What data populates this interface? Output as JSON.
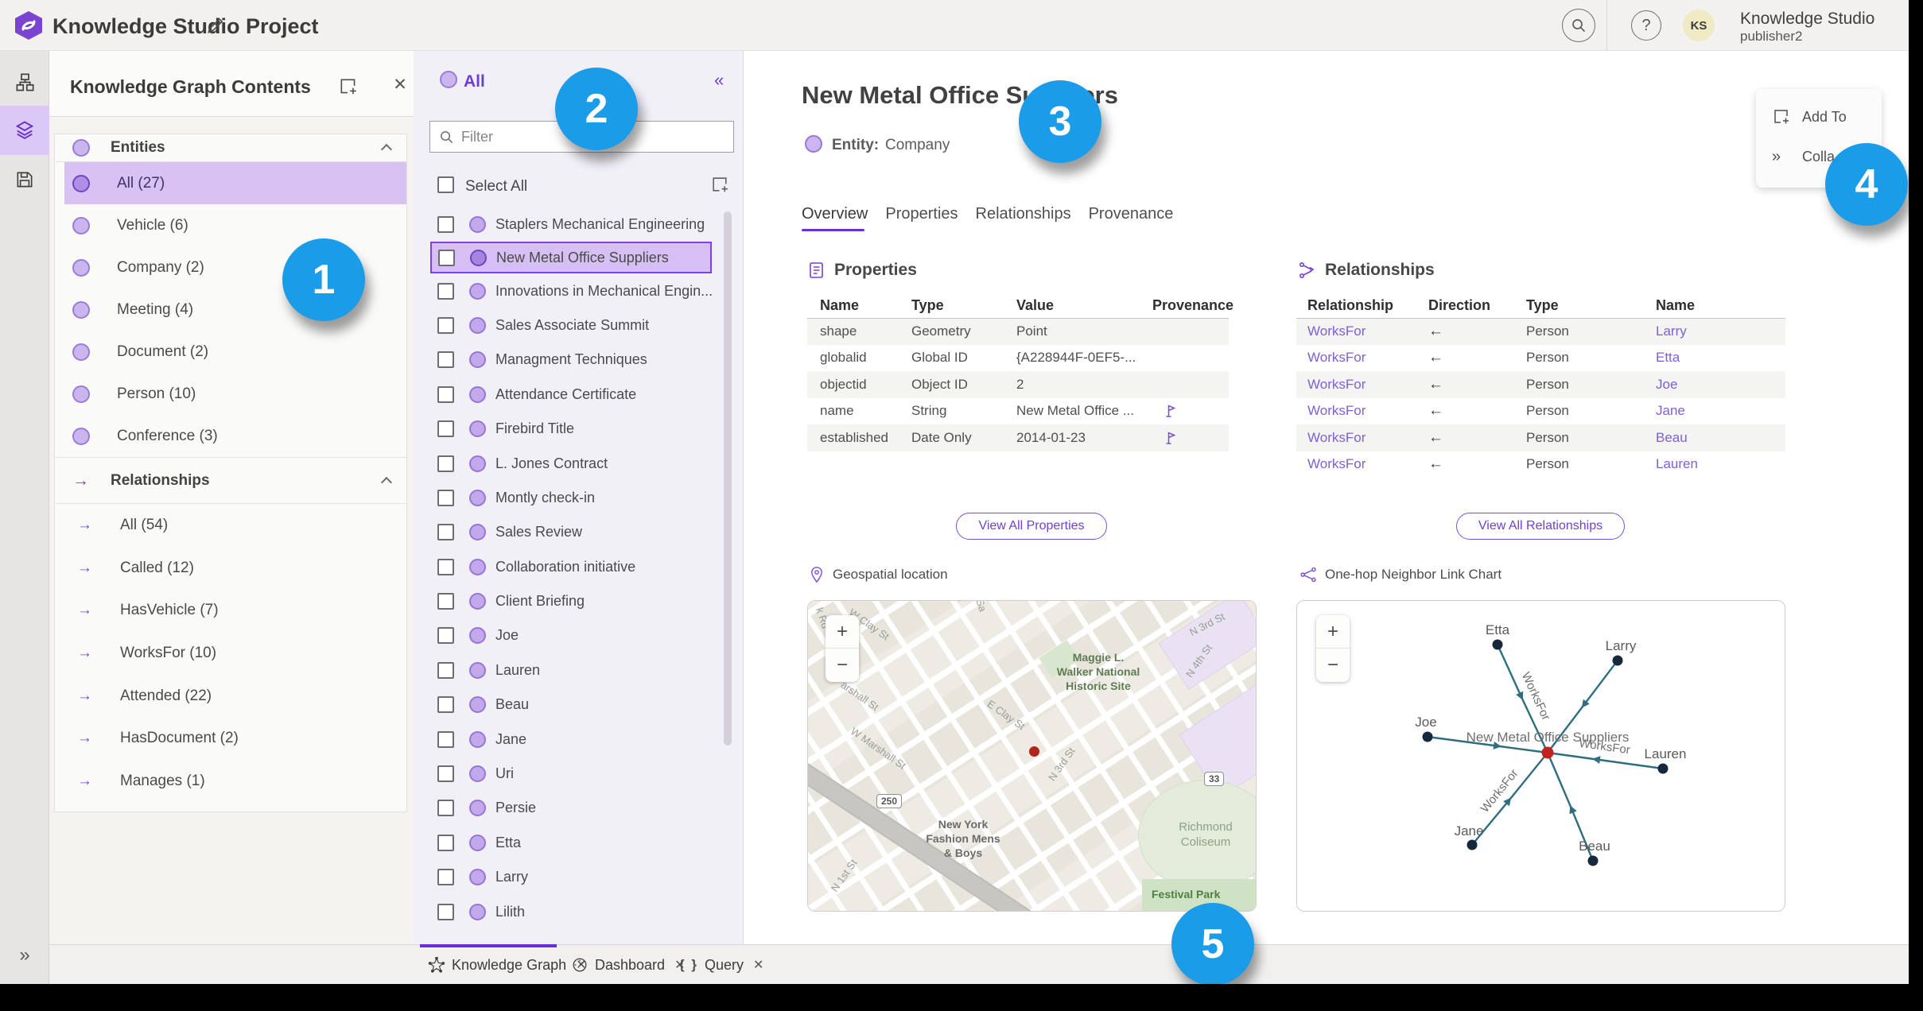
{
  "topbar": {
    "title": "Knowledge Studio Project",
    "help_glyph": "?",
    "avatar_initials": "KS",
    "account_name": "Knowledge Studio",
    "account_user": "publisher2"
  },
  "kg_panel": {
    "title": "Knowledge Graph Contents",
    "entities": {
      "label": "Entities",
      "items": [
        {
          "label": "All (27)",
          "selected": true
        },
        {
          "label": "Vehicle (6)"
        },
        {
          "label": "Company (2)"
        },
        {
          "label": "Meeting (4)"
        },
        {
          "label": "Document (2)"
        },
        {
          "label": "Person (10)"
        },
        {
          "label": "Conference (3)"
        }
      ]
    },
    "relationships": {
      "label": "Relationships",
      "items": [
        {
          "label": "All (54)"
        },
        {
          "label": "Called (12)"
        },
        {
          "label": "HasVehicle (7)"
        },
        {
          "label": "WorksFor (10)"
        },
        {
          "label": "Attended (22)"
        },
        {
          "label": "HasDocument (2)"
        },
        {
          "label": "Manages (1)"
        }
      ]
    }
  },
  "list_panel": {
    "header": "All",
    "collapse_glyph": "«",
    "filter_placeholder": "Filter",
    "select_all": "Select All",
    "items": [
      {
        "label": "Staplers Mechanical Engineering"
      },
      {
        "label": "New Metal Office Suppliers",
        "selected": true
      },
      {
        "label": "Innovations in Mechanical Engin..."
      },
      {
        "label": "Sales Associate Summit"
      },
      {
        "label": "Managment Techniques"
      },
      {
        "label": "Attendance Certificate"
      },
      {
        "label": "Firebird Title"
      },
      {
        "label": "L. Jones Contract"
      },
      {
        "label": "Montly check-in"
      },
      {
        "label": "Sales Review"
      },
      {
        "label": "Collaboration initiative"
      },
      {
        "label": "Client Briefing"
      },
      {
        "label": "Joe"
      },
      {
        "label": "Lauren"
      },
      {
        "label": "Beau"
      },
      {
        "label": "Jane"
      },
      {
        "label": "Uri"
      },
      {
        "label": "Persie"
      },
      {
        "label": "Etta"
      },
      {
        "label": "Larry"
      },
      {
        "label": "Lilith"
      }
    ]
  },
  "detail": {
    "title": "New Metal Office Suppliers",
    "entity_label": "Entity:",
    "entity_type": "Company",
    "tabs": [
      {
        "label": "Overview",
        "active": true
      },
      {
        "label": "Properties"
      },
      {
        "label": "Relationships"
      },
      {
        "label": "Provenance"
      }
    ],
    "properties": {
      "title": "Properties",
      "columns": [
        "Name",
        "Type",
        "Value",
        "Provenance"
      ],
      "rows": [
        {
          "name": "shape",
          "type": "Geometry",
          "value": "Point",
          "flag": false
        },
        {
          "name": "globalid",
          "type": "Global ID",
          "value": "{A228944F-0EF5-...",
          "flag": false
        },
        {
          "name": "objectid",
          "type": "Object ID",
          "value": "2",
          "flag": false
        },
        {
          "name": "name",
          "type": "String",
          "value": "New Metal Office ...",
          "flag": true
        },
        {
          "name": "established",
          "type": "Date Only",
          "value": "2014-01-23",
          "flag": true
        }
      ],
      "view_all": "View All Properties"
    },
    "relationships": {
      "title": "Relationships",
      "columns": [
        "Relationship",
        "Direction",
        "Type",
        "Name"
      ],
      "rows": [
        {
          "relationship": "WorksFor",
          "direction": "←",
          "type": "Person",
          "name": "Larry"
        },
        {
          "relationship": "WorksFor",
          "direction": "←",
          "type": "Person",
          "name": "Etta"
        },
        {
          "relationship": "WorksFor",
          "direction": "←",
          "type": "Person",
          "name": "Joe"
        },
        {
          "relationship": "WorksFor",
          "direction": "←",
          "type": "Person",
          "name": "Jane"
        },
        {
          "relationship": "WorksFor",
          "direction": "←",
          "type": "Person",
          "name": "Beau"
        },
        {
          "relationship": "WorksFor",
          "direction": "←",
          "type": "Person",
          "name": "Lauren"
        }
      ],
      "view_all": "View All Relationships"
    },
    "geospatial_title": "Geospatial location",
    "link_chart_title": "One-hop Neighbor Link Chart"
  },
  "map": {
    "zoom_in": "+",
    "zoom_out": "−",
    "labels": {
      "k_rd": "k Rd",
      "sa": "Sa",
      "w_clay": "W Clay St",
      "e_clay": "E Clay St",
      "marshall": "arshall St",
      "w_marshall": "W Marshall St",
      "n_3rd_center": "N 3rd St",
      "n_3rd_topright": "N 3rd St",
      "n_4th": "N 4th St",
      "n_1st": "N 1st St",
      "shield_250": "250",
      "shield_33": "33",
      "maggie_1": "Maggie L.",
      "maggie_2": "Walker National",
      "maggie_3": "Historic Site",
      "nyf_1": "New York",
      "nyf_2": "Fashion Mens",
      "nyf_3": "& Boys",
      "coliseum_1": "Richmond",
      "coliseum_2": "Coliseum",
      "festival": "Festival Park"
    }
  },
  "link_chart": {
    "zoom_in": "+",
    "zoom_out": "−",
    "center": "New Metal Office Suppliers",
    "edge_label": "WorksFor",
    "nodes": [
      "Etta",
      "Larry",
      "Joe",
      "Lauren",
      "Jane",
      "Beau"
    ]
  },
  "popup": {
    "add_to": "Add To",
    "collapse": "Colla"
  },
  "bottom_tabs": [
    {
      "label": "Knowledge Graph",
      "active": true
    },
    {
      "label": "Dashboard"
    },
    {
      "label": "Query",
      "icon_text": "{ }"
    }
  ],
  "annotations": [
    "1",
    "2",
    "3",
    "4",
    "5"
  ],
  "colors": {
    "accent_purple": "#7a42d6",
    "selection_purple": "#d6bff3",
    "annotation_blue": "#1b9ce8",
    "link_purple": "#7e5fd6",
    "edge_teal": "#2e6e80",
    "marker_red": "#b22318"
  }
}
